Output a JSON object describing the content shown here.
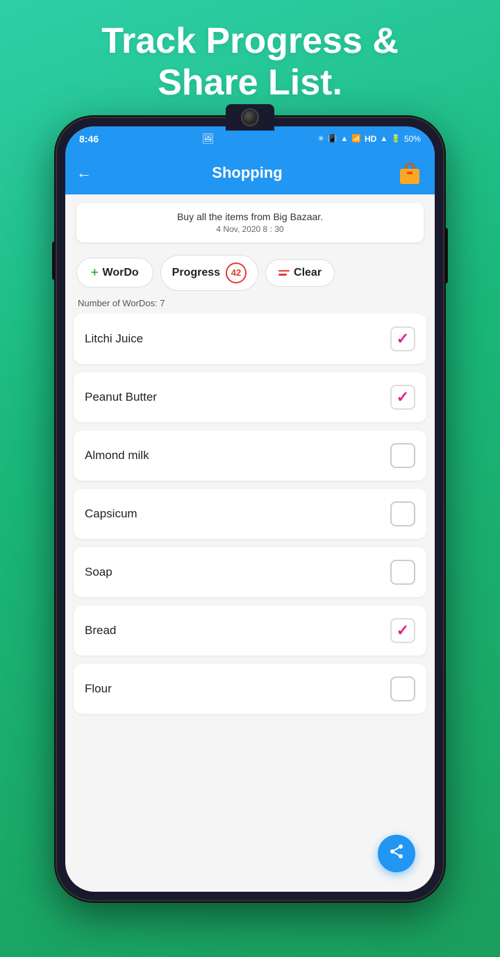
{
  "headline": {
    "line1": "Track Progress &",
    "line2": "Share List."
  },
  "status_bar": {
    "time": "8:46",
    "battery": "50%",
    "icons": "🔵 📳 🔷 📶 HD 📶 🔋"
  },
  "app_bar": {
    "title": "Shopping",
    "back_label": "←"
  },
  "description": {
    "text": "Buy all the items from Big Bazaar.",
    "date": "4 Nov, 2020 8 : 30"
  },
  "buttons": {
    "wordo_label": "WorDo",
    "progress_label": "Progress",
    "progress_count": "42",
    "clear_label": "Clear"
  },
  "counter": {
    "label": "Number of WorDos: 7"
  },
  "items": [
    {
      "name": "Litchi Juice",
      "checked": true
    },
    {
      "name": "Peanut Butter",
      "checked": true
    },
    {
      "name": "Almond milk",
      "checked": false
    },
    {
      "name": "Capsicum",
      "checked": false
    },
    {
      "name": "Soap",
      "checked": false
    },
    {
      "name": "Bread",
      "checked": true
    },
    {
      "name": "Flour",
      "checked": false
    }
  ],
  "colors": {
    "primary": "#2196f3",
    "accent": "#e91e8c",
    "danger": "#e53935",
    "success": "#4caf50",
    "bg": "#f5f5f5"
  }
}
